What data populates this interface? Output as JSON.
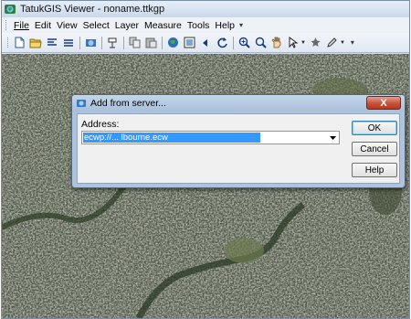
{
  "window": {
    "title": "TatukGIS Viewer - noname.ttkgp"
  },
  "menubar": {
    "items": [
      "File",
      "Edit",
      "View",
      "Select",
      "Layer",
      "Measure",
      "Tools",
      "Help"
    ],
    "underlined": [
      "F",
      "E",
      "V",
      "S",
      "L",
      "M",
      "T",
      "H"
    ]
  },
  "toolbar": {
    "icons": [
      "new-file-icon",
      "open-folder-icon",
      "align-icon",
      "list-icon",
      "globe-add-icon",
      "layer-icon",
      "copy-icon",
      "paste-icon",
      "globe-icon",
      "zoom-extent-icon",
      "back-icon",
      "refresh-icon",
      "zoom-in-icon",
      "zoom-icon",
      "hand-pan-icon",
      "select-arrow-icon",
      "star-icon",
      "pen-edit-icon"
    ]
  },
  "dialog": {
    "title": "Add from server...",
    "close_label": "X",
    "address_label": "Address:",
    "address_value": "ecwp://...                                              lbourne.ecw",
    "ok_label": "OK",
    "cancel_label": "Cancel",
    "help_label": "Help"
  }
}
